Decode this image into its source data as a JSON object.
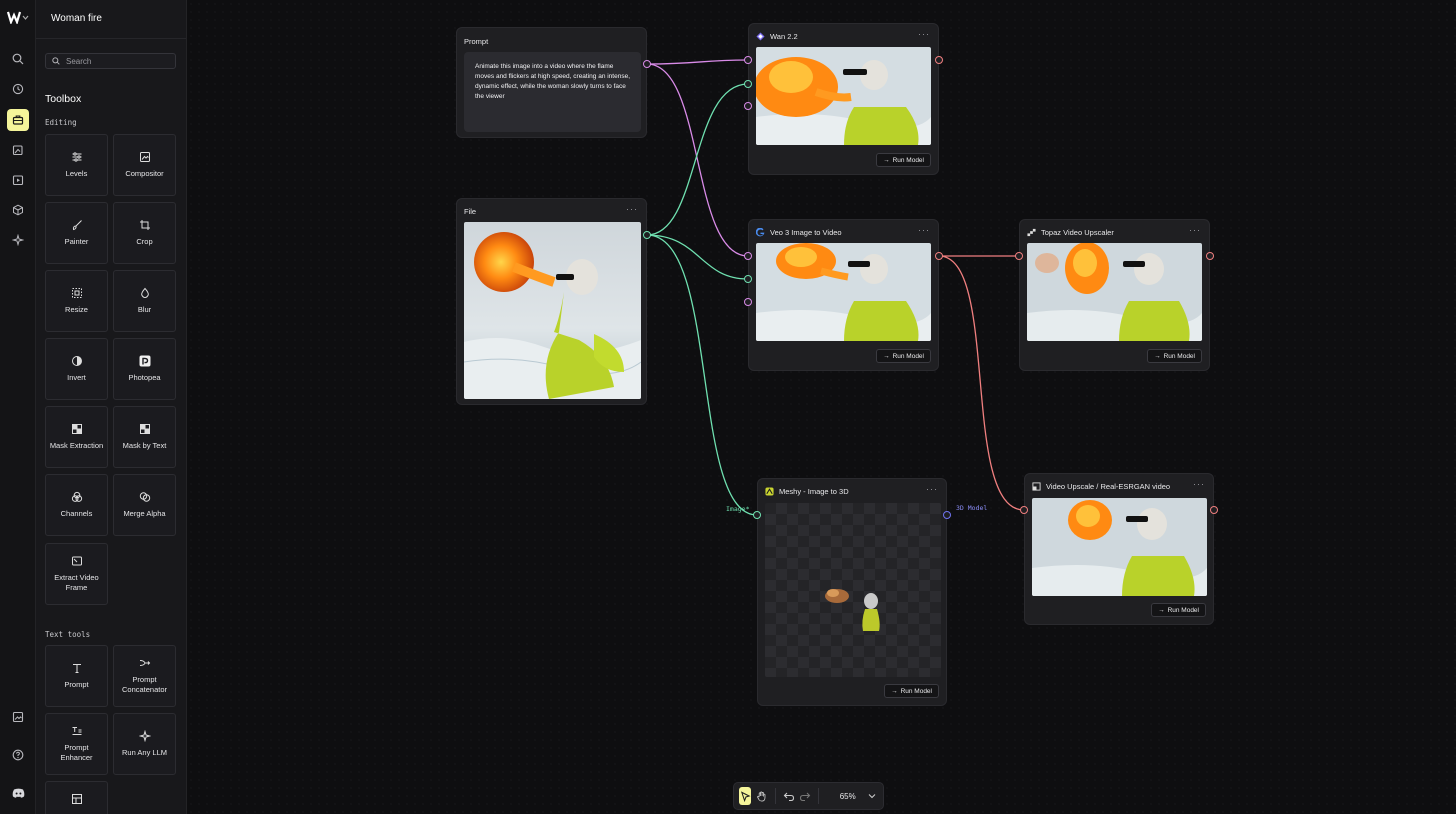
{
  "workspace": {
    "title": "Woman fire"
  },
  "search": {
    "placeholder": "Search"
  },
  "toolbox": {
    "title": "Toolbox",
    "editing_label": "Editing",
    "text_tools_label": "Text tools",
    "editing": [
      "Levels",
      "Compositor",
      "Painter",
      "Crop",
      "Resize",
      "Blur",
      "Invert",
      "Photopea",
      "Mask Extraction",
      "Mask by Text",
      "Channels",
      "Merge Alpha",
      "Extract Video Frame"
    ],
    "text_tools": [
      "Prompt",
      "Prompt Concatenator",
      "Prompt Enhancer",
      "Run Any LLM"
    ]
  },
  "nodes": {
    "prompt": {
      "title": "Prompt",
      "text": "Animate this image into a video where the flame moves and flickers at high speed, creating an intense, dynamic effect, while the woman slowly turns to face the viewer"
    },
    "file": {
      "title": "File"
    },
    "wan": {
      "title": "Wan 2.2",
      "run": "Run Model"
    },
    "veo": {
      "title": "Veo 3 Image to Video",
      "run": "Run Model"
    },
    "topaz": {
      "title": "Topaz Video Upscaler",
      "run": "Run Model"
    },
    "meshy": {
      "title": "Meshy - Image to 3D",
      "run": "Run Model",
      "in_label": "Image*",
      "out_label": "3D Model"
    },
    "esrgan": {
      "title": "Video Upscale / Real-ESRGAN video",
      "run": "Run Model"
    }
  },
  "bottombar": {
    "zoom": "65%"
  },
  "colors": {
    "accent": "#f4f49a",
    "prompt_wire": "#d98be8",
    "image_wire": "#6fe0b0",
    "video_wire": "#f07f7f",
    "model_port": "#6f73f0"
  }
}
